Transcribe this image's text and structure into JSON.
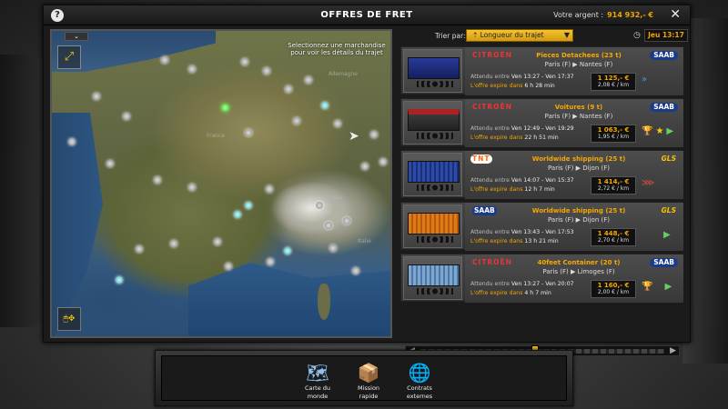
{
  "header": {
    "help": "?",
    "title": "OFFRES DE FRET",
    "money_label": "Votre argent :",
    "money_value": "914 932,- €",
    "close": "✕"
  },
  "map": {
    "hint": "Selectionnez une marchandise pour voir les détails du trajet",
    "collapse": "⌄",
    "regions": [
      "Allemagne",
      "France",
      "Suisse",
      "Italie"
    ]
  },
  "sort": {
    "label": "Trier par:",
    "value": "Longueur du trajet",
    "date": "Jeu 13:17"
  },
  "colors": {
    "accent": "#f6a800",
    "price_bg": "#111111"
  },
  "offers": [
    {
      "company": "CITROËN",
      "cargo": "Pieces Detachees (23 t)",
      "from": "Paris",
      "from_country": "(F)",
      "to": "Nantes",
      "to_country": "(F)",
      "wait_label": "Attendu entre",
      "window": "Ven 13:27 - Ven 17:37",
      "expire_label": "L'offre expire dans",
      "expire": "6 h 28 min",
      "price": "1 125,- €",
      "per_km": "2,08 € / km",
      "target_logo": "SAAB",
      "trailer_color": "#1d2a7a",
      "icons": [
        "arrows-fast"
      ]
    },
    {
      "company": "CITROËN",
      "cargo": "Voitures (9 t)",
      "from": "Paris",
      "from_country": "(F)",
      "to": "Nantes",
      "to_country": "(F)",
      "wait_label": "Attendu entre",
      "window": "Ven 12:49 - Ven 19:29",
      "expire_label": "L'offre expire dans",
      "expire": "22 h 51 min",
      "price": "1 063,- €",
      "per_km": "1,95 € / km",
      "target_logo": "SAAB",
      "trailer_color": "#7a1a1a",
      "icons": [
        "trophy",
        "star",
        "arrow-green"
      ]
    },
    {
      "company": "TNT",
      "cargo": "Worldwide shipping (25 t)",
      "from": "Paris",
      "from_country": "(F)",
      "to": "Dijon",
      "to_country": "(F)",
      "wait_label": "Attendu entre",
      "window": "Ven 14:07 - Ven 15:37",
      "expire_label": "L'offre expire dans",
      "expire": "12 h 7 min",
      "price": "1 414,- €",
      "per_km": "2,72 € / km",
      "target_logo": "GLS",
      "trailer_color": "#243a8a",
      "icons": [
        "arrows-red"
      ]
    },
    {
      "company": "SAAB",
      "cargo": "Worldwide shipping (25 t)",
      "from": "Paris",
      "from_country": "(F)",
      "to": "Dijon",
      "to_country": "(F)",
      "wait_label": "Attendu entre",
      "window": "Ven 13:43 - Ven 17:53",
      "expire_label": "L'offre expire dans",
      "expire": "13 h 21 min",
      "price": "1 448,- €",
      "per_km": "2,70 € / km",
      "target_logo": "GLS",
      "trailer_color": "#d26a10",
      "icons": [
        "arrow-green"
      ]
    },
    {
      "company": "CITROËN",
      "cargo": "40feet Container (20 t)",
      "from": "Paris",
      "from_country": "(F)",
      "to": "Limoges",
      "to_country": "(F)",
      "wait_label": "Attendu entre",
      "window": "Ven 13:27 - Ven 20:07",
      "expire_label": "L'offre expire dans",
      "expire": "4 h 7 min",
      "price": "1 160,- €",
      "per_km": "2,00 € / km",
      "target_logo": "SAAB",
      "trailer_color": "#3a6aa8",
      "icons": [
        "trophy",
        "arrow-green"
      ]
    }
  ],
  "dock": [
    {
      "label1": "Carte du",
      "label2": "monde"
    },
    {
      "label1": "Mission",
      "label2": "rapide"
    },
    {
      "label1": "Contrats",
      "label2": "externes"
    }
  ]
}
